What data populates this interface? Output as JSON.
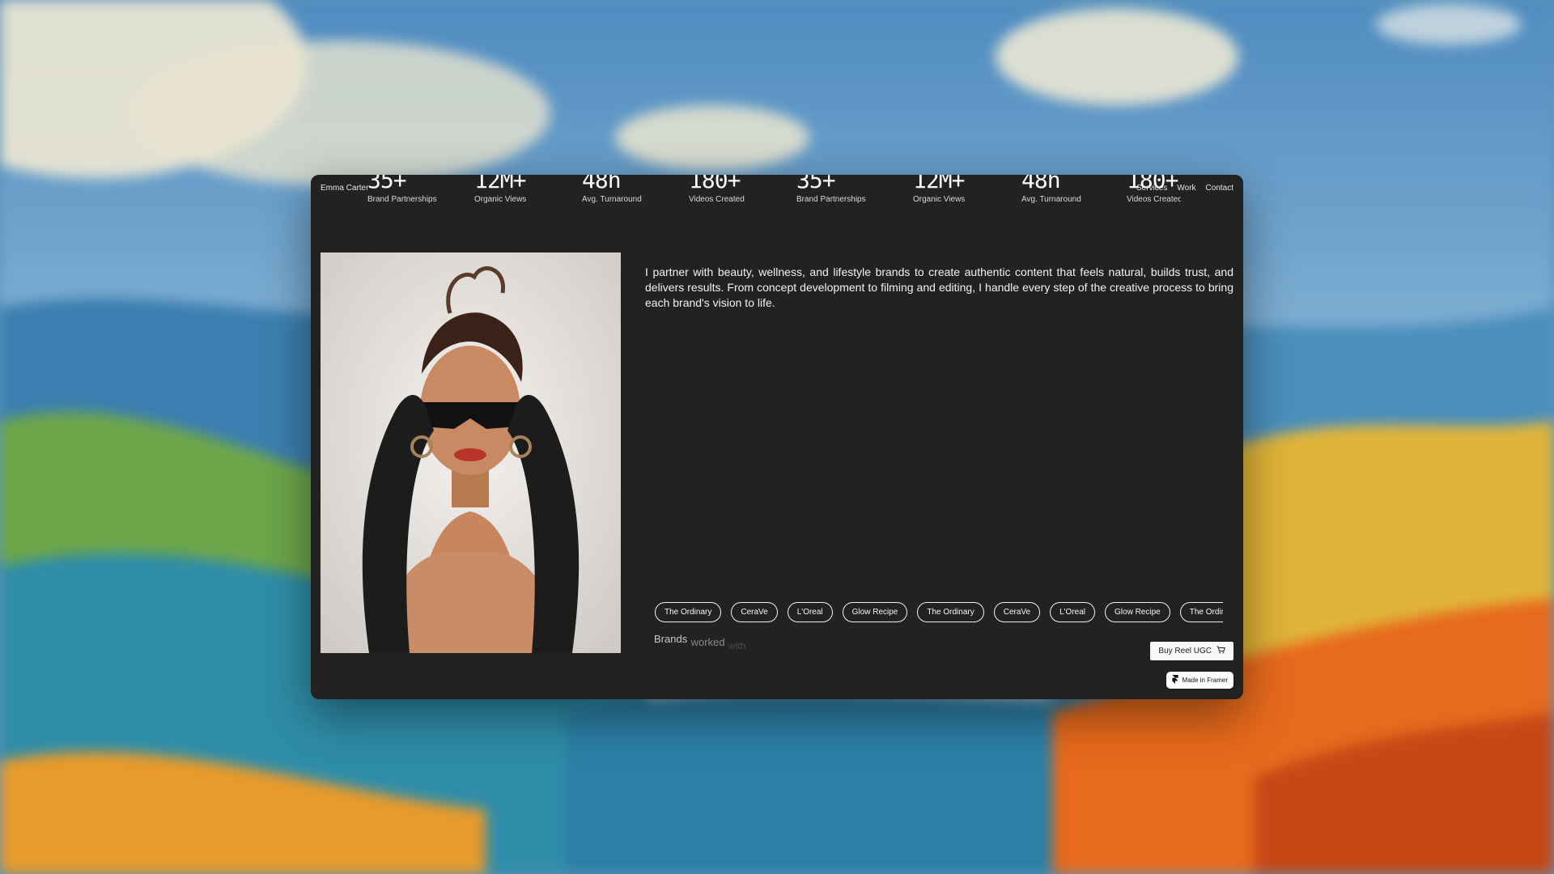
{
  "site": {
    "brand": "Emma Carter",
    "nav": [
      "Services",
      "Work",
      "Contact"
    ]
  },
  "stats": [
    {
      "value": "35+",
      "label": "Brand Partnerships"
    },
    {
      "value": "12M+",
      "label": "Organic Views"
    },
    {
      "value": "48h",
      "label": "Avg. Turnaround"
    },
    {
      "value": "180+",
      "label": "Videos Created"
    },
    {
      "value": "35+",
      "label": "Brand Partnerships"
    },
    {
      "value": "12M+",
      "label": "Organic Views"
    },
    {
      "value": "48h",
      "label": "Avg. Turnaround"
    },
    {
      "value": "180+",
      "label": "Videos Created"
    }
  ],
  "about": {
    "text": "I partner with beauty, wellness, and lifestyle brands to create authentic content that feels natural, builds trust, and delivers results. From concept development to filming and editing, I handle every step of the creative process to bring each brand's vision to life."
  },
  "brands": {
    "items": [
      "The Ordinary",
      "CeraVe",
      "L'Oreal",
      "Glow Recipe",
      "The Ordinary",
      "CeraVe",
      "L'Oreal",
      "Glow Recipe",
      "The Ordinary"
    ],
    "heading": [
      "Brands",
      "worked",
      "with"
    ]
  },
  "cta": {
    "buy_label": "Buy Reel UGC",
    "buy_icon": "cart-icon",
    "framer_label": "Made in Framer",
    "framer_icon": "framer-logo-icon"
  },
  "colors": {
    "window_bg": "#222222",
    "text": "#f2f2f2",
    "button_bg": "#f7f7f7"
  }
}
